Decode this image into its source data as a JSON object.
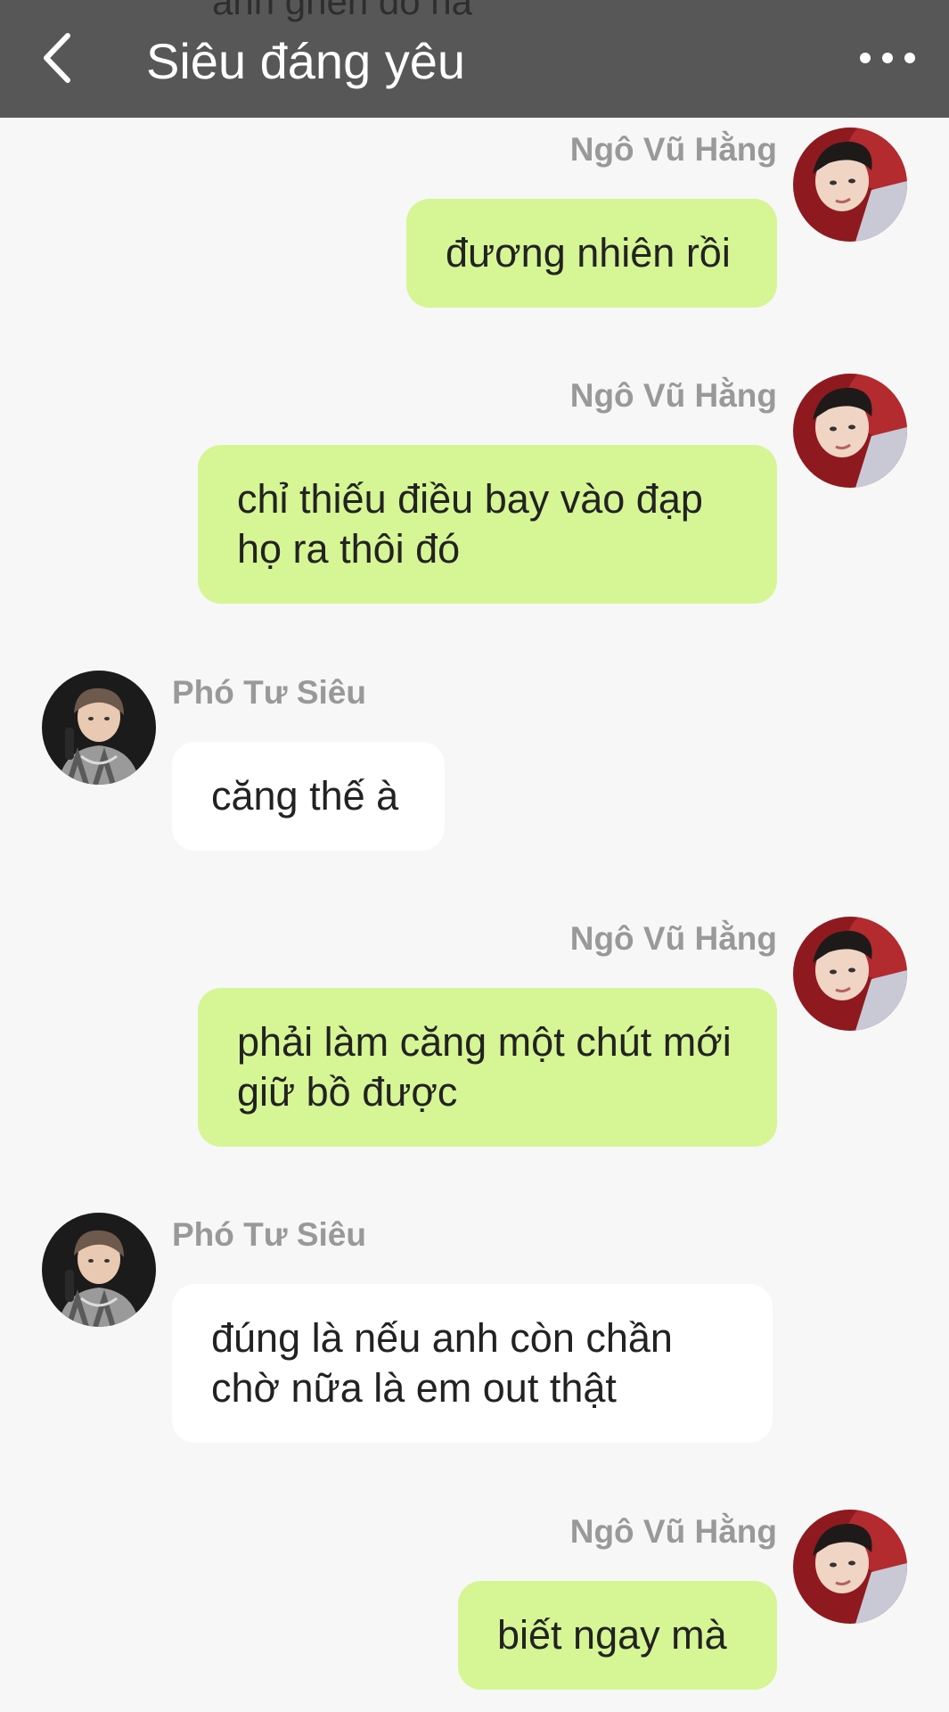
{
  "header": {
    "title": "Siêu đáng yêu",
    "partial_previous_text": "anh ghen đó hả",
    "back_icon": "chevron-left-icon",
    "more_icon": "more-horizontal-icon"
  },
  "colors": {
    "header_bg": "#575757",
    "outgoing_bubble": "#d6f594",
    "incoming_bubble": "#ffffff",
    "background": "#f7f7f7",
    "name_text": "#999999"
  },
  "messages": [
    {
      "sender": "Ngô Vũ Hằng",
      "direction": "outgoing",
      "text": "đương nhiên rồi"
    },
    {
      "sender": "Ngô Vũ Hằng",
      "direction": "outgoing",
      "text": "chỉ thiếu điều bay vào đạp họ ra thôi đó"
    },
    {
      "sender": "Phó Tư Siêu",
      "direction": "incoming",
      "text": "căng thế à"
    },
    {
      "sender": "Ngô Vũ Hằng",
      "direction": "outgoing",
      "text": "phải làm căng một chút mới giữ bồ được"
    },
    {
      "sender": "Phó Tư Siêu",
      "direction": "incoming",
      "text": "đúng là nếu anh còn chần chờ nữa là em out thật"
    },
    {
      "sender": "Ngô Vũ Hằng",
      "direction": "outgoing",
      "text": "biết ngay mà"
    }
  ]
}
